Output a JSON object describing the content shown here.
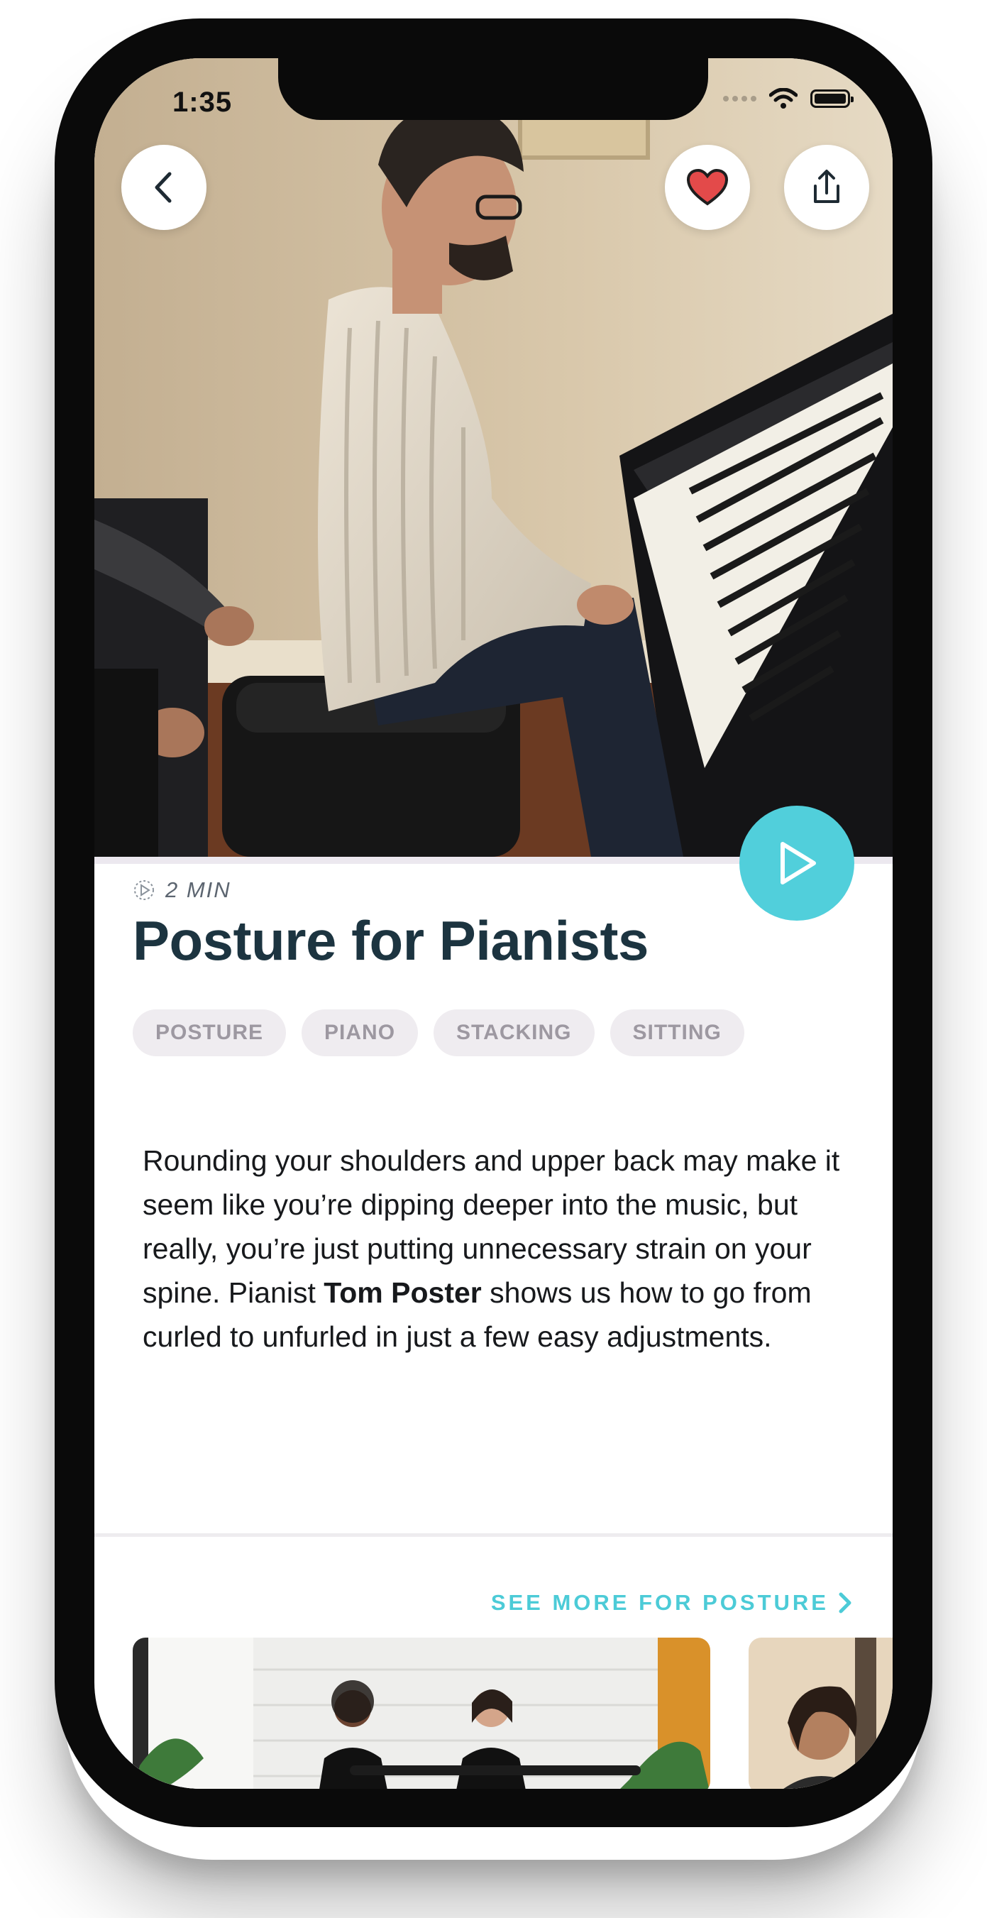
{
  "status_bar": {
    "time": "1:35"
  },
  "header": {
    "back_icon": "chevron-left-icon",
    "favorite_icon": "heart-icon",
    "share_icon": "share-icon",
    "accent_color": "#51cfdb",
    "heart_color": "#e34a4a"
  },
  "video": {
    "duration": "2 MIN",
    "title": "Posture for Pianists",
    "play_icon": "play-icon"
  },
  "tags": [
    "POSTURE",
    "PIANO",
    "STACKING",
    "SITTING"
  ],
  "description": {
    "before": "Rounding your shoulders and upper back may make it seem like you’re dipping deeper into the music, but really, you’re just putting unnecessary strain on your spine. Pianist ",
    "bold": "Tom Poster",
    "after": " shows us how to go from curled to unfurled in just a few easy adjustments."
  },
  "related": {
    "see_more_label": "SEE MORE FOR POSTURE",
    "see_more_icon": "chevron-right-icon"
  }
}
